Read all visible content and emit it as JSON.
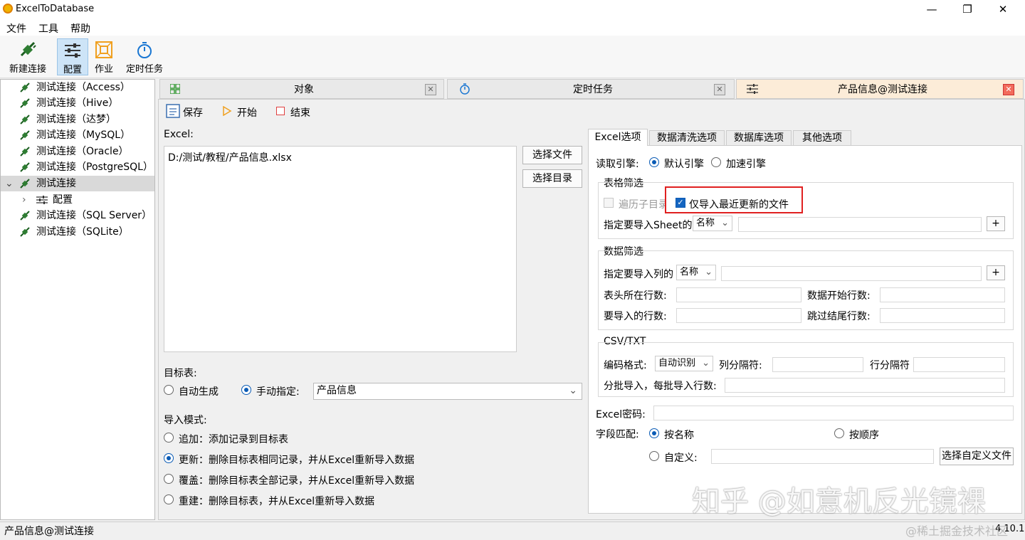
{
  "window": {
    "title": "ExcelToDatabase"
  },
  "menu": [
    "文件",
    "工具",
    "帮助"
  ],
  "toolbar": {
    "new_connection": "新建连接",
    "config": "配置",
    "job": "作业",
    "scheduled_task": "定时任务"
  },
  "tree": {
    "items": [
      "测试连接（Access）",
      "测试连接（Hive）",
      "测试连接（达梦）",
      "测试连接（MySQL）",
      "测试连接（Oracle）",
      "测试连接（PostgreSQL）",
      "测试连接",
      "配置",
      "测试连接（SQL Server）",
      "测试连接（SQLite）"
    ]
  },
  "tabs": {
    "object": "对象",
    "scheduled": "定时任务",
    "product": "产品信息@测试连接"
  },
  "actions": {
    "save": "保存",
    "start": "开始",
    "end": "结束"
  },
  "excel": {
    "label": "Excel:",
    "path": "D:/测试/教程/产品信息.xlsx",
    "choose_file": "选择文件",
    "choose_dir": "选择目录"
  },
  "target": {
    "label": "目标表:",
    "auto": "自动生成",
    "manual": "手动指定:",
    "table": "产品信息"
  },
  "import_mode": {
    "label": "导入模式:",
    "options": [
      "追加：添加记录到目标表",
      "更新：删除目标表相同记录，并从Excel重新导入数据",
      "覆盖：删除目标表全部记录，并从Excel重新导入数据",
      "重建：删除目标表，并从Excel重新导入数据"
    ],
    "selected": 1
  },
  "options_tabs": [
    "Excel选项",
    "数据清洗选项",
    "数据库选项",
    "其他选项"
  ],
  "excel_options": {
    "engine_label": "读取引擎:",
    "engine_default": "默认引擎",
    "engine_fast": "加速引擎",
    "table_filter": "表格筛选",
    "traverse": "遍历子目录",
    "latest_only": "仅导入最近更新的文件",
    "sheet_label": "指定要导入Sheet的",
    "sheet_select": "名称",
    "plus": "+",
    "data_filter": "数据筛选",
    "column_label": "指定要导入列的",
    "column_select": "名称",
    "header_row": "表头所在行数:",
    "data_start_row": "数据开始行数:",
    "rows_to_import": "要导入的行数:",
    "skip_tail_rows": "跳过结尾行数:",
    "csv_title": "CSV/TXT",
    "encoding_label": "编码格式:",
    "encoding_value": "自动识别",
    "col_sep": "列分隔符:",
    "row_sep": "行分隔符",
    "batch_label": "分批导入，每批导入行数:",
    "password_label": "Excel密码:",
    "field_match": "字段匹配:",
    "by_name": "按名称",
    "by_order": "按顺序",
    "custom": "自定义:",
    "choose_custom": "选择自定义文件"
  },
  "status": {
    "left": "产品信息@测试连接",
    "version": "4.10.1"
  },
  "watermark": {
    "zhihu": "知乎 @如意机反光镜裸",
    "juejin": "@稀土掘金技术社区"
  },
  "colors": {
    "accent": "#0a5bb5",
    "highlight_border": "#e02020",
    "active_tab": "#fcecd8",
    "tree_icon": "#2e7d32"
  }
}
